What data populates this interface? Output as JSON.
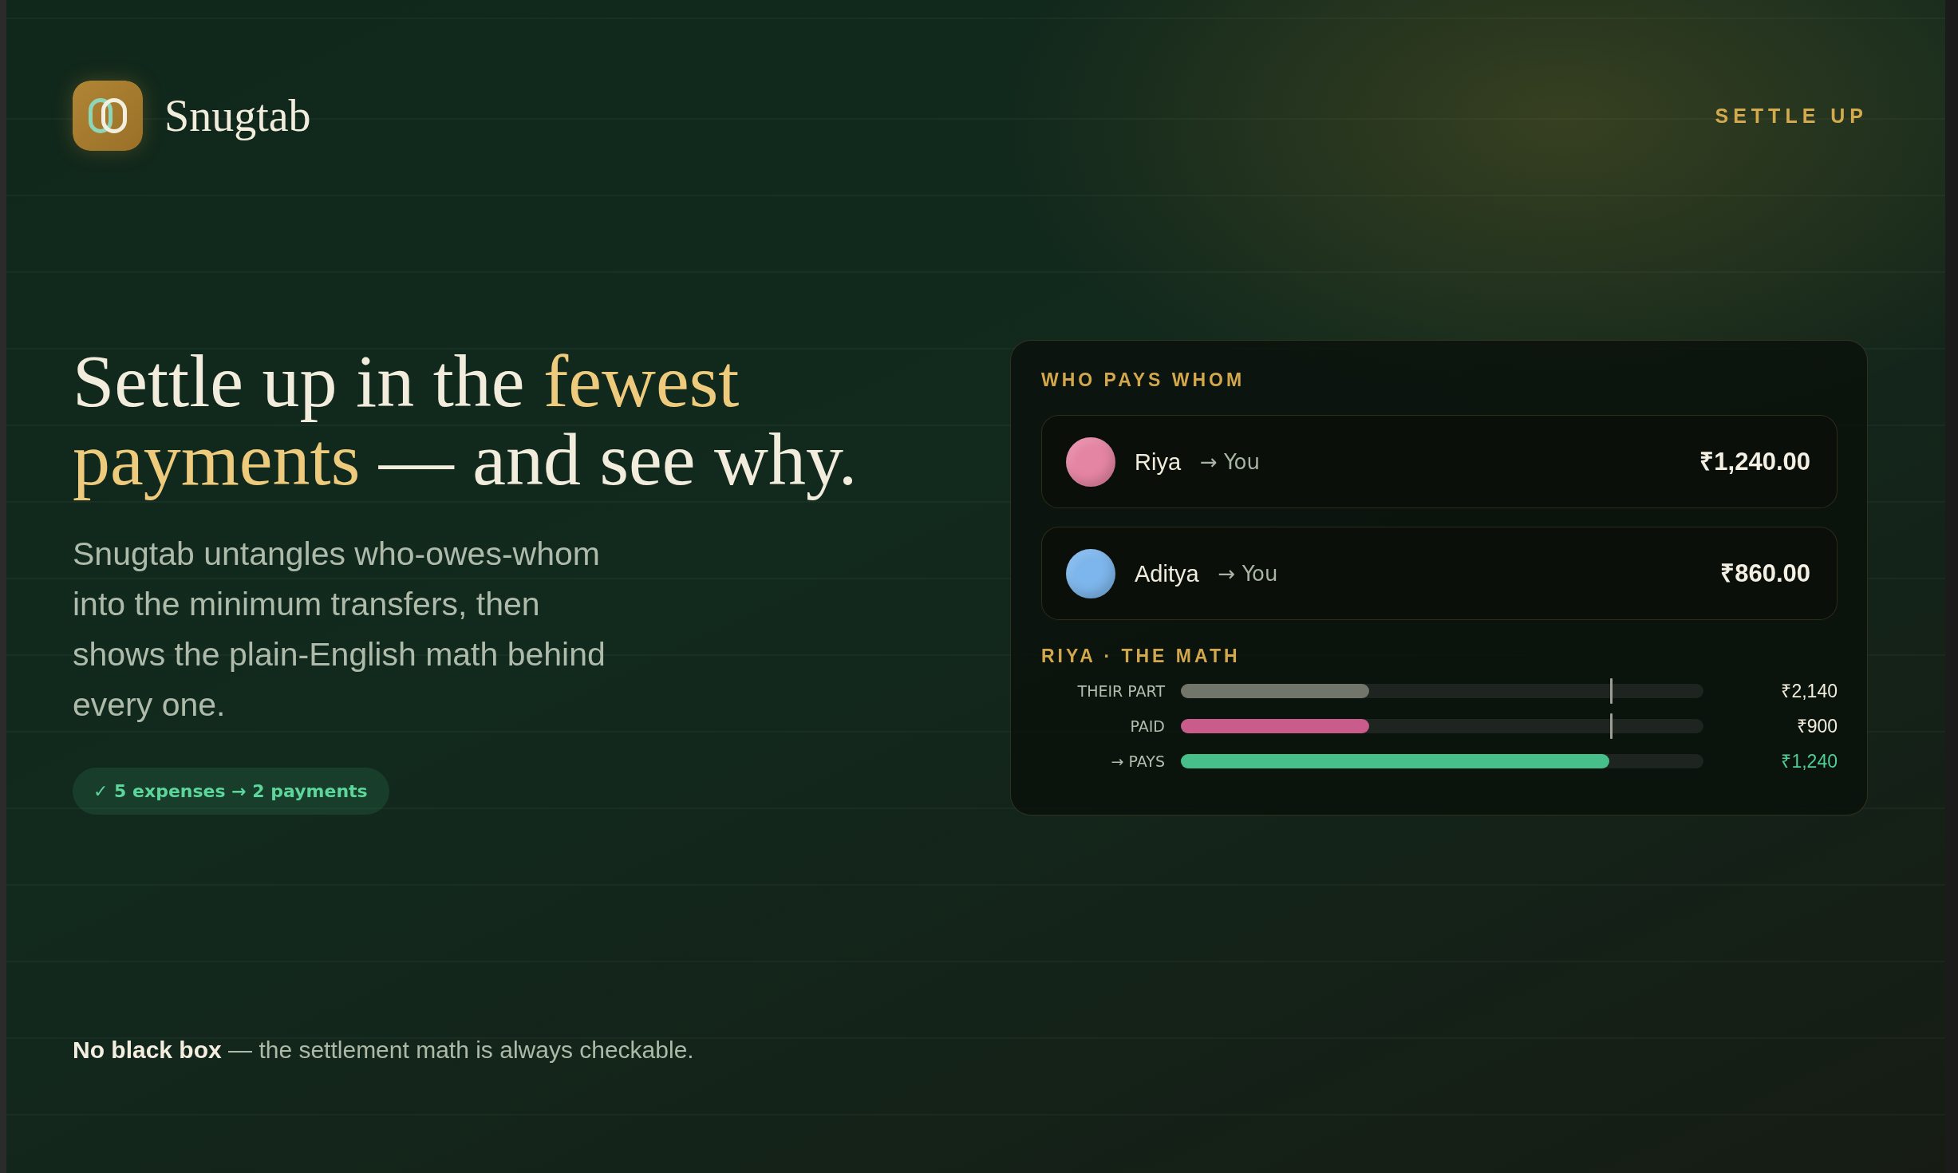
{
  "brand": {
    "name": "Snugtab"
  },
  "nav": {
    "link": "SETTLE UP"
  },
  "hero": {
    "headline": [
      {
        "text": "Settle up in the ",
        "highlight": false
      },
      {
        "text": "fewest payments",
        "highlight": true
      },
      {
        "text": " — and see why.",
        "highlight": false
      }
    ],
    "description": "Snugtab untangles who-owes-whom into the minimum transfers, then shows the plain-English math behind every one.",
    "badge": "✓ 5 expenses → 2 payments"
  },
  "card": {
    "title": "WHO PAYS WHOM",
    "payments": [
      {
        "from": "Riya",
        "to": "→ You",
        "amount": "₹1,240.00",
        "color": "#e585a4"
      },
      {
        "from": "Aditya",
        "to": "→ You",
        "amount": "₹860.00",
        "color": "#7db6ec"
      }
    ],
    "math": {
      "title": "RIYA · THE MATH",
      "rows": [
        {
          "label": "THEIR PART",
          "kind": "part",
          "level": 0.36,
          "color": "#72756a",
          "marker": {
            "level": 0.824
          },
          "value": "₹2,140"
        },
        {
          "label": "PAID",
          "kind": "paid",
          "level": 0.36,
          "color": "#c95c8b",
          "marker": {
            "level": 0.824
          },
          "value": "₹900"
        },
        {
          "label": "→ PAYS",
          "kind": "result",
          "level": 0.82,
          "color": "#46bf8a",
          "value": "₹1,240"
        }
      ]
    }
  },
  "footer": "**No black box** — the settlement math is always checkable."
}
